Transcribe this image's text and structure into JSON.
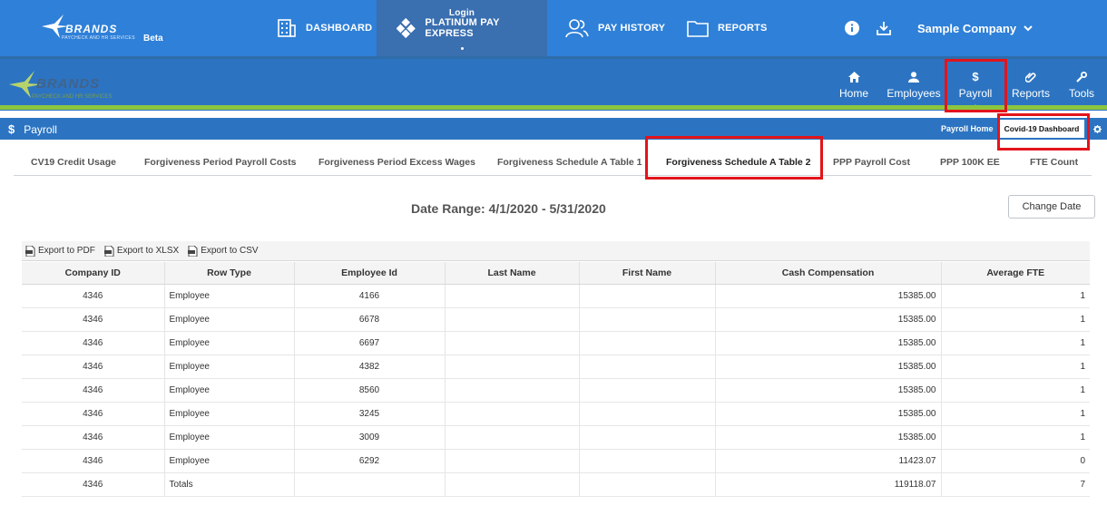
{
  "topbar": {
    "brand_name": "BRANDS",
    "brand_tagline": "PAYCHECK AND HR SERVICES",
    "beta_label": "Beta",
    "nav": [
      {
        "label": "DASHBOARD",
        "icon": "building-icon"
      },
      {
        "label": "PLATINUM PAY EXPRESS",
        "icon": "diamond-grid-icon",
        "hover_label": "Login",
        "active": true
      },
      {
        "label": "PAY HISTORY",
        "icon": "users-icon"
      },
      {
        "label": "REPORTS",
        "icon": "folder-icon"
      }
    ],
    "company": "Sample Company"
  },
  "subheader": {
    "logo_text": "BRANDS",
    "logo_tagline": "PAYCHECK AND HR SERVICES",
    "modules": [
      {
        "label": "Home",
        "icon": "home-icon"
      },
      {
        "label": "Employees",
        "icon": "person-icon"
      },
      {
        "label": "Payroll",
        "icon": "dollar-icon",
        "active": true
      },
      {
        "label": "Reports",
        "icon": "paperclip-icon"
      },
      {
        "label": "Tools",
        "icon": "wrench-icon"
      }
    ]
  },
  "payroll_bar": {
    "title": "Payroll",
    "dollar": "$",
    "links": [
      "Payroll Home",
      "Covid-19 Dashboard"
    ]
  },
  "tabs": [
    "CV19 Credit Usage",
    "Forgiveness Period Payroll Costs",
    "Forgiveness Period Excess Wages",
    "Forgiveness Schedule A Table 1",
    "Forgiveness Schedule A Table 2",
    "PPP Payroll Cost",
    "PPP 100K EE",
    "FTE Count"
  ],
  "active_tab": "Forgiveness Schedule A Table 2",
  "report": {
    "date_range": "Date Range: 4/1/2020 - 5/31/2020",
    "change_date_label": "Change Date",
    "exports": [
      "Export to PDF",
      "Export to XLSX",
      "Export to CSV"
    ],
    "columns": [
      "Company ID",
      "Row Type",
      "Employee Id",
      "Last Name",
      "First Name",
      "Cash Compensation",
      "Average FTE"
    ],
    "rows": [
      [
        "4346",
        "Employee",
        "4166",
        "",
        "",
        "15385.00",
        "1"
      ],
      [
        "4346",
        "Employee",
        "6678",
        "",
        "",
        "15385.00",
        "1"
      ],
      [
        "4346",
        "Employee",
        "6697",
        "",
        "",
        "15385.00",
        "1"
      ],
      [
        "4346",
        "Employee",
        "4382",
        "",
        "",
        "15385.00",
        "1"
      ],
      [
        "4346",
        "Employee",
        "8560",
        "",
        "",
        "15385.00",
        "1"
      ],
      [
        "4346",
        "Employee",
        "3245",
        "",
        "",
        "15385.00",
        "1"
      ],
      [
        "4346",
        "Employee",
        "3009",
        "",
        "",
        "15385.00",
        "1"
      ],
      [
        "4346",
        "Employee",
        "6292",
        "",
        "",
        "11423.07",
        "0"
      ],
      [
        "4346",
        "Totals",
        "",
        "",
        "",
        "119118.07",
        "7"
      ]
    ]
  },
  "highlight_color": "#e2141b",
  "accent_green": "#8cc63f",
  "header_blue": "#2f80d8"
}
